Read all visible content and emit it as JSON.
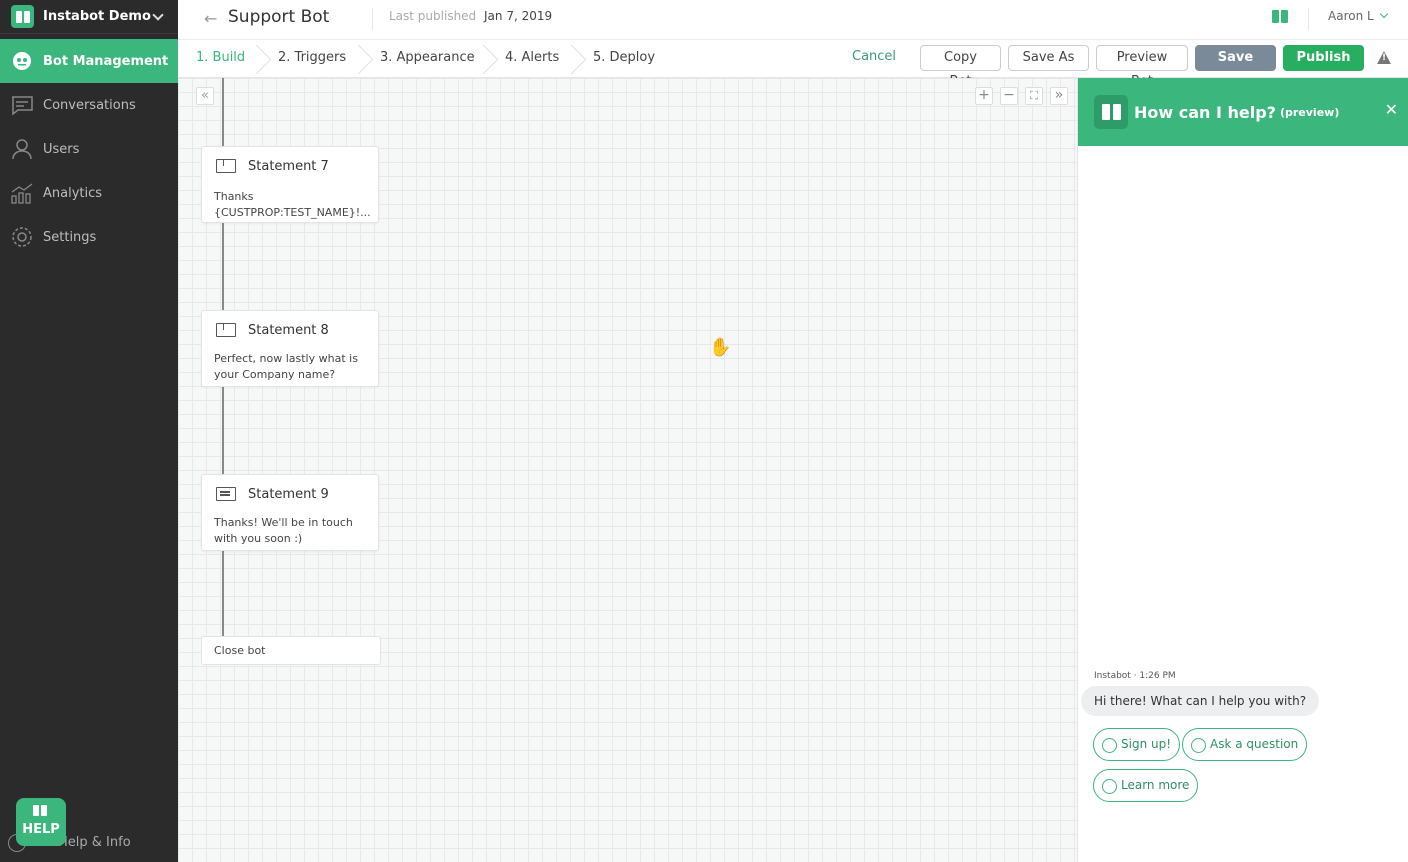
{
  "sidebar": {
    "brand": "Instabot Demo",
    "items": [
      {
        "label": "Bot Management",
        "icon": "robot-icon"
      },
      {
        "label": "Conversations",
        "icon": "chat-icon"
      },
      {
        "label": "Users",
        "icon": "user-icon"
      },
      {
        "label": "Analytics",
        "icon": "analytics-icon"
      },
      {
        "label": "Settings",
        "icon": "gear-icon"
      }
    ],
    "help_button": "HELP",
    "help_info": "Help & Info"
  },
  "header": {
    "title": "Support Bot",
    "last_published_label": "Last published",
    "last_published_date": "Jan 7, 2019",
    "user": "Aaron L"
  },
  "steps": [
    "1. Build",
    "2. Triggers",
    "3. Appearance",
    "4. Alerts",
    "5. Deploy"
  ],
  "actions": {
    "cancel": "Cancel",
    "copy": "Copy Bot",
    "save_as": "Save As",
    "preview": "Preview Bot",
    "save": "Save",
    "publish": "Publish"
  },
  "canvas": {
    "nodes": [
      {
        "title": "Statement 7",
        "body": "Thanks {CUSTPROP:TEST_NAME}!..."
      },
      {
        "title": "Statement 8",
        "body": "Perfect, now lastly what is your Company name?"
      },
      {
        "title": "Statement 9",
        "body": "Thanks! We'll be in touch with you soon :)"
      }
    ],
    "close_node": "Close bot",
    "controls": {
      "zoom_in": "+",
      "zoom_out": "−",
      "fit": "⛶",
      "expand": "»",
      "collapse": "«"
    }
  },
  "preview": {
    "title": "How can I help?",
    "subtitle": "(preview)",
    "meta": "Instabot · 1:26 PM",
    "message": "Hi there! What can I help you with?",
    "options": [
      "Sign up!",
      "Ask a question",
      "Learn more"
    ]
  },
  "colors": {
    "accent": "#3bb77e",
    "sidebar": "#2b2b2b",
    "save": "#7b8a99",
    "publish": "#27ae60"
  }
}
